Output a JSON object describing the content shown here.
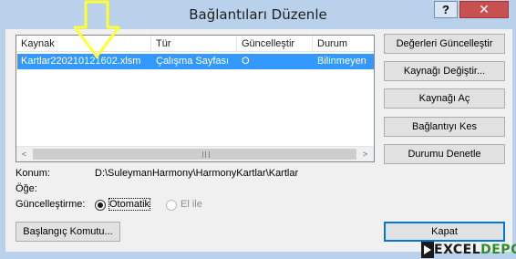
{
  "window": {
    "title": "Bağlantıları Düzenle",
    "help_label": "?",
    "close_label": "✕"
  },
  "links_list": {
    "columns": [
      "Kaynak",
      "Tür",
      "Güncelleştir",
      "Durum"
    ],
    "rows": [
      {
        "source": "Kartlar220210121602.xlsm",
        "type": "Çalışma Sayfası",
        "update": "O",
        "status": "Bilinmeyen",
        "selected": true
      }
    ],
    "scroll_left": "<",
    "scroll_right": ">"
  },
  "buttons": {
    "update_values": "Değerleri Güncelleştir",
    "change_source": "Kaynağı Değiştir...",
    "open_source": "Kaynağı Aç",
    "break_link": "Bağlantıyı Kes",
    "check_status": "Durumu Denetle",
    "startup_prompt": "Başlangıç Komutu...",
    "close": "Kapat"
  },
  "details": {
    "location_label": "Konum:",
    "location_value": "D:\\SuleymanHarmony\\HarmonyKartlar\\Kartlar",
    "item_label": "Öğe:",
    "update_label": "Güncelleştirme:",
    "update_options": [
      {
        "label": "Otomatik",
        "checked": true,
        "enabled": true
      },
      {
        "label": "El ile",
        "checked": false,
        "enabled": false
      }
    ]
  },
  "watermark": {
    "text": "EXCEL",
    "suffix": "DEPO"
  },
  "colors": {
    "selection": "#3399ff",
    "frame": "#b9d1ea",
    "close": "#c75050",
    "annotation": "#ffff33",
    "default_button_border": "#0078d7"
  }
}
